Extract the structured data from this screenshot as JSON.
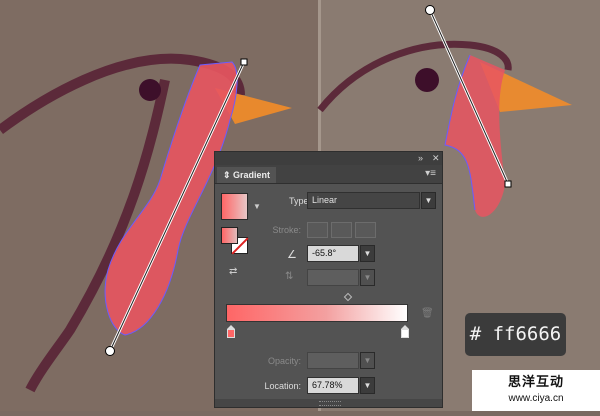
{
  "scene": {
    "background_left": "#7e6c62",
    "background_right": "#8a7c72",
    "bird_outline_color": "#5a2a38",
    "beak_color": "#e88a30",
    "wattle_color": "#ff6666",
    "selection_color": "#6a5cff"
  },
  "panel": {
    "collapse_icon": "double-chevron-icon",
    "close_icon": "close-icon",
    "tab_label": "Gradient",
    "menu_icon": "panel-menu-icon",
    "type_label": "Type:",
    "type_value": "Linear",
    "stroke_label": "Stroke:",
    "angle_value": "-65.8°",
    "opacity_label": "Opacity:",
    "location_label": "Location:",
    "location_value": "67.78%",
    "gradient_start_color": "#ff6666",
    "gradient_end_color": "#ffffff"
  },
  "hex_label": "# ff6666",
  "watermark": {
    "text": "思洋互动",
    "url": "www.ciya.cn"
  }
}
